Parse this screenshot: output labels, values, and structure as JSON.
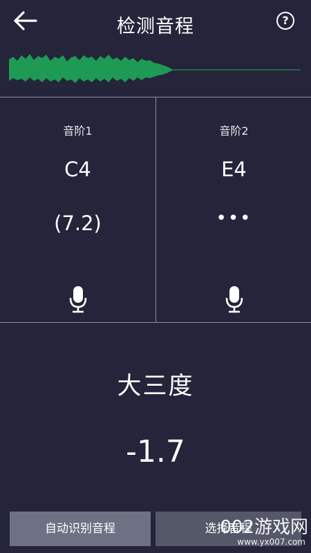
{
  "header": {
    "title": "检测音程",
    "back_icon": "arrow-left-icon",
    "help_icon": "help-circle-icon",
    "help_glyph": "?"
  },
  "waveform": {
    "color": "#1e9a55",
    "line_color": "#2a7a4e"
  },
  "scale1": {
    "label": "音阶1",
    "note": "C4",
    "cents": "(7.2)",
    "mic_icon": "microphone-icon"
  },
  "scale2": {
    "label": "音阶2",
    "note": "E4",
    "status": "•••",
    "mic_icon": "microphone-icon"
  },
  "result": {
    "interval": "大三度",
    "deviation": "-1.7"
  },
  "buttons": {
    "auto_detect": "自动识别音程",
    "select_interval": "选择音程"
  },
  "watermark": {
    "text": "002游戏网",
    "url": "www.yx007.com"
  },
  "colors": {
    "background": "#24243a",
    "divider": "#8a8aa0",
    "button_left": "#6e7084",
    "button_right": "#555869"
  }
}
